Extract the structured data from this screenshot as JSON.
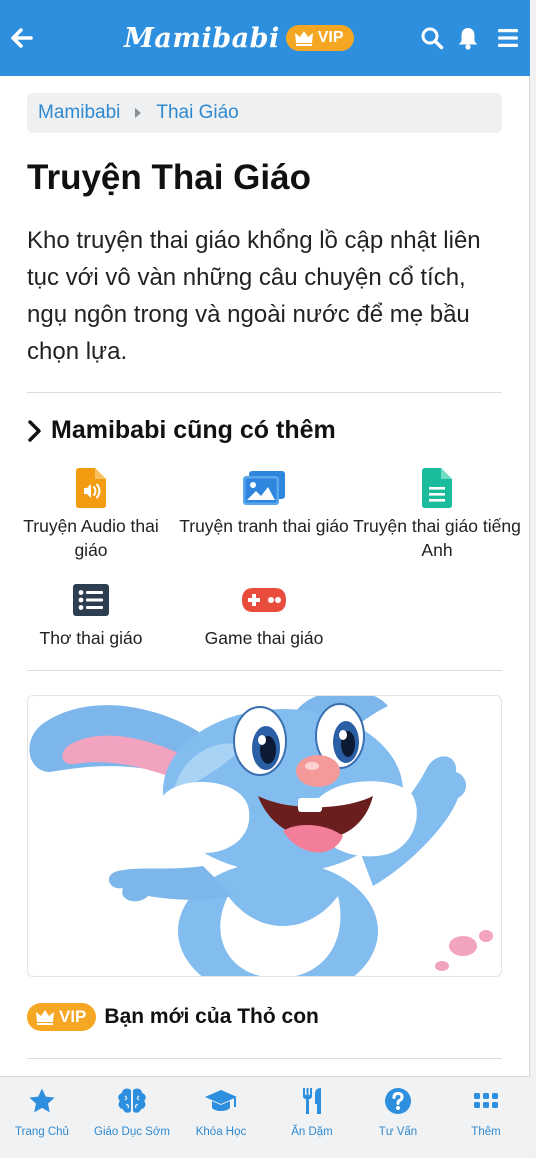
{
  "header": {
    "logo_text": "Mamibabi",
    "vip_label": "VIP",
    "brand_color": "#2e8fde",
    "vip_color": "#f5a623",
    "icons": [
      "back-arrow-icon",
      "search-icon",
      "bell-icon",
      "menu-icon"
    ]
  },
  "breadcrumb": [
    "Mamibabi",
    "Thai Giáo"
  ],
  "page": {
    "title": "Truyện Thai Giáo",
    "description": "Kho truyện thai giáo khổng lồ cập nhật liên tục với vô vàn những câu chuyện cổ tích, ngụ ngôn trong và ngoài nước để mẹ bầu chọn lựa."
  },
  "section": {
    "title": "Mamibabi cũng có thêm"
  },
  "categories": [
    {
      "label": "Truyện Audio thai giáo",
      "icon": "audio-file-icon",
      "color": "#f39c12"
    },
    {
      "label": "Truyện tranh thai giáo",
      "icon": "image-icon",
      "color": "#2e86de"
    },
    {
      "label": "Truyện thai giáo tiếng Anh",
      "icon": "document-icon",
      "color": "#1abc9c"
    },
    {
      "label": "Thơ thai giáo",
      "icon": "list-icon",
      "color": "#2c3e50"
    },
    {
      "label": "Game thai giáo",
      "icon": "gamepad-icon",
      "color": "#e74c3c"
    }
  ],
  "story": {
    "vip_label": "VIP",
    "title": "Bạn mới của Thỏ con",
    "image": "bunny-illustration"
  },
  "bottom_nav": [
    {
      "label": "Trang Chủ",
      "icon": "star-icon"
    },
    {
      "label": "Giáo Dục Sớm",
      "icon": "brain-icon"
    },
    {
      "label": "Khóa Học",
      "icon": "graduation-cap-icon"
    },
    {
      "label": "Ăn Dặm",
      "icon": "utensils-icon"
    },
    {
      "label": "Tư Vấn",
      "icon": "question-icon"
    },
    {
      "label": "Thêm",
      "icon": "grid-icon"
    }
  ]
}
